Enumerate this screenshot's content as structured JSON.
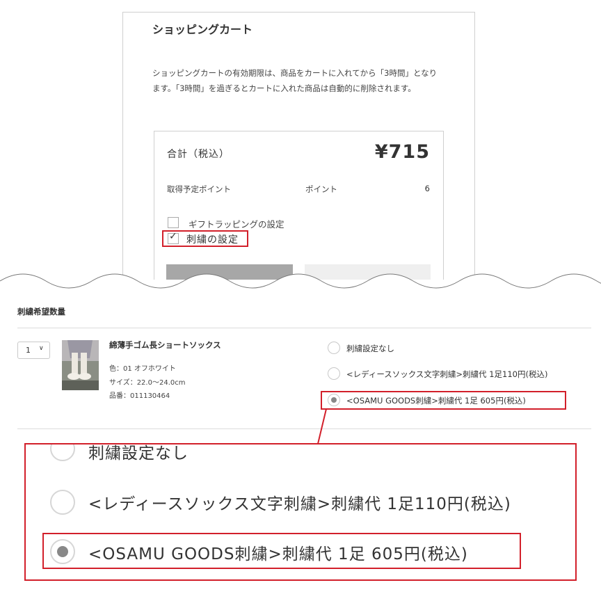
{
  "cart": {
    "title": "ショッピングカート",
    "description": "ショッピングカートの有効期限は、商品をカートに入れてから「3時間」となります。「3時間」を過ぎるとカートに入れた商品は自動的に削除されます。",
    "total_label": "合計（税込）",
    "total_value": "¥715",
    "points_label": "取得予定ポイント",
    "points_unit": "ポイント",
    "points_value": "6",
    "gift_label": "ギフトラッピングの設定",
    "gift_checked": false,
    "embroidery_label": "刺繍の設定",
    "embroidery_checked": true
  },
  "embroidery": {
    "heading": "刺繍希望数量",
    "quantity": "1",
    "product": {
      "name": "綿薄手ゴム長ショートソックス",
      "color": "色：01 オフホワイト",
      "size": "サイズ：22.0〜24.0cm",
      "sku": "品番：011130464"
    },
    "options": [
      {
        "label": "刺繍設定なし",
        "selected": false
      },
      {
        "label": "<レディースソックス文字刺繍>刺繍代 1足110円(税込)",
        "selected": false
      },
      {
        "label": "<OSAMU GOODS刺繍>刺繍代 1足 605円(税込)",
        "selected": true
      }
    ]
  },
  "colors": {
    "highlight": "#d21f2a",
    "button_primary": "#a7a7a7",
    "button_secondary": "#efefef"
  }
}
